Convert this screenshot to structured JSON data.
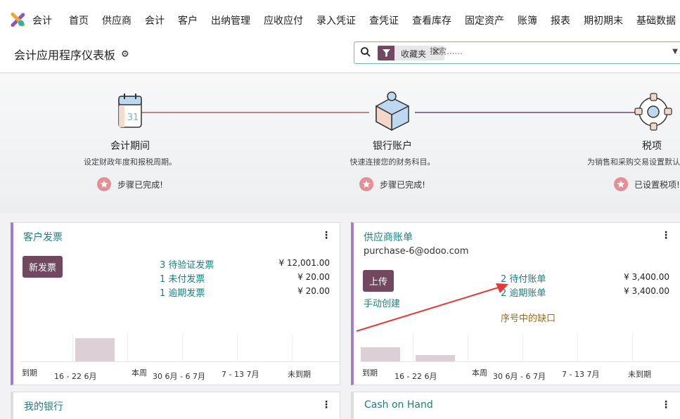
{
  "nav": {
    "app_name": "会计",
    "menu": [
      "首页",
      "供应商",
      "会计",
      "客户",
      "出纳管理",
      "应收应付",
      "录入凭证",
      "查凭证",
      "查看库存",
      "固定资产",
      "账簿",
      "报表",
      "期初期末",
      "基础数据"
    ]
  },
  "control": {
    "title": "会计应用程序仪表板",
    "facet_label": "收藏夹",
    "search_placeholder": "搜索......"
  },
  "onboarding": {
    "steps": [
      {
        "title": "会计期间",
        "desc": "设定财政年度和报税周期。",
        "status": "步骤已完成!",
        "icon": "calendar-icon",
        "calendar_day": "31"
      },
      {
        "title": "银行账户",
        "desc": "快速连接您的财务科目。",
        "status": "步骤已完成!",
        "icon": "puzzle-icon"
      },
      {
        "title": "税项",
        "desc": "为销售和采购交易设置默认税项。",
        "status": "已设置税项!",
        "icon": "gear-icon"
      }
    ]
  },
  "cards": {
    "customer": {
      "title": "客户发票",
      "button": "新发票",
      "stats": [
        {
          "label": "3 待验证发票",
          "value": "¥ 12,001.00"
        },
        {
          "label": "1 未付发票",
          "value": "¥ 20.00"
        },
        {
          "label": "1 逾期发票",
          "value": "¥ 20.00"
        }
      ],
      "xlabels": [
        "到期",
        "16 - 22 6月",
        "本周",
        "30 6月 - 6 7月",
        "7 - 13 7月",
        "未到期"
      ],
      "chart_values": [
        0,
        0.92,
        0,
        0,
        0,
        0
      ]
    },
    "vendor": {
      "title": "供应商账单",
      "email": "purchase-6@odoo.com",
      "button": "上传",
      "manual": "手动创建",
      "stats": [
        {
          "label": "2 待付账单",
          "value": "¥ 3,400.00"
        },
        {
          "label": "2 逾期账单",
          "value": "¥ 3,400.00"
        }
      ],
      "warning": "序号中的缺口",
      "xlabels": [
        "到期",
        "16 - 22 6月",
        "本周",
        "30 6月 - 6 7月",
        "7 - 13 7月",
        "未到期"
      ],
      "chart_values": [
        0.55,
        0.25,
        0,
        0,
        0,
        0
      ]
    },
    "bank": {
      "title": "我的银行"
    },
    "cash": {
      "title": "Cash on Hand"
    }
  },
  "colors": {
    "brand": "#71485f",
    "teal": "#1b7f84",
    "card_accent": "#a07ecd",
    "done_badge": "#e48f94",
    "annotation_arrow": "#e53935"
  }
}
